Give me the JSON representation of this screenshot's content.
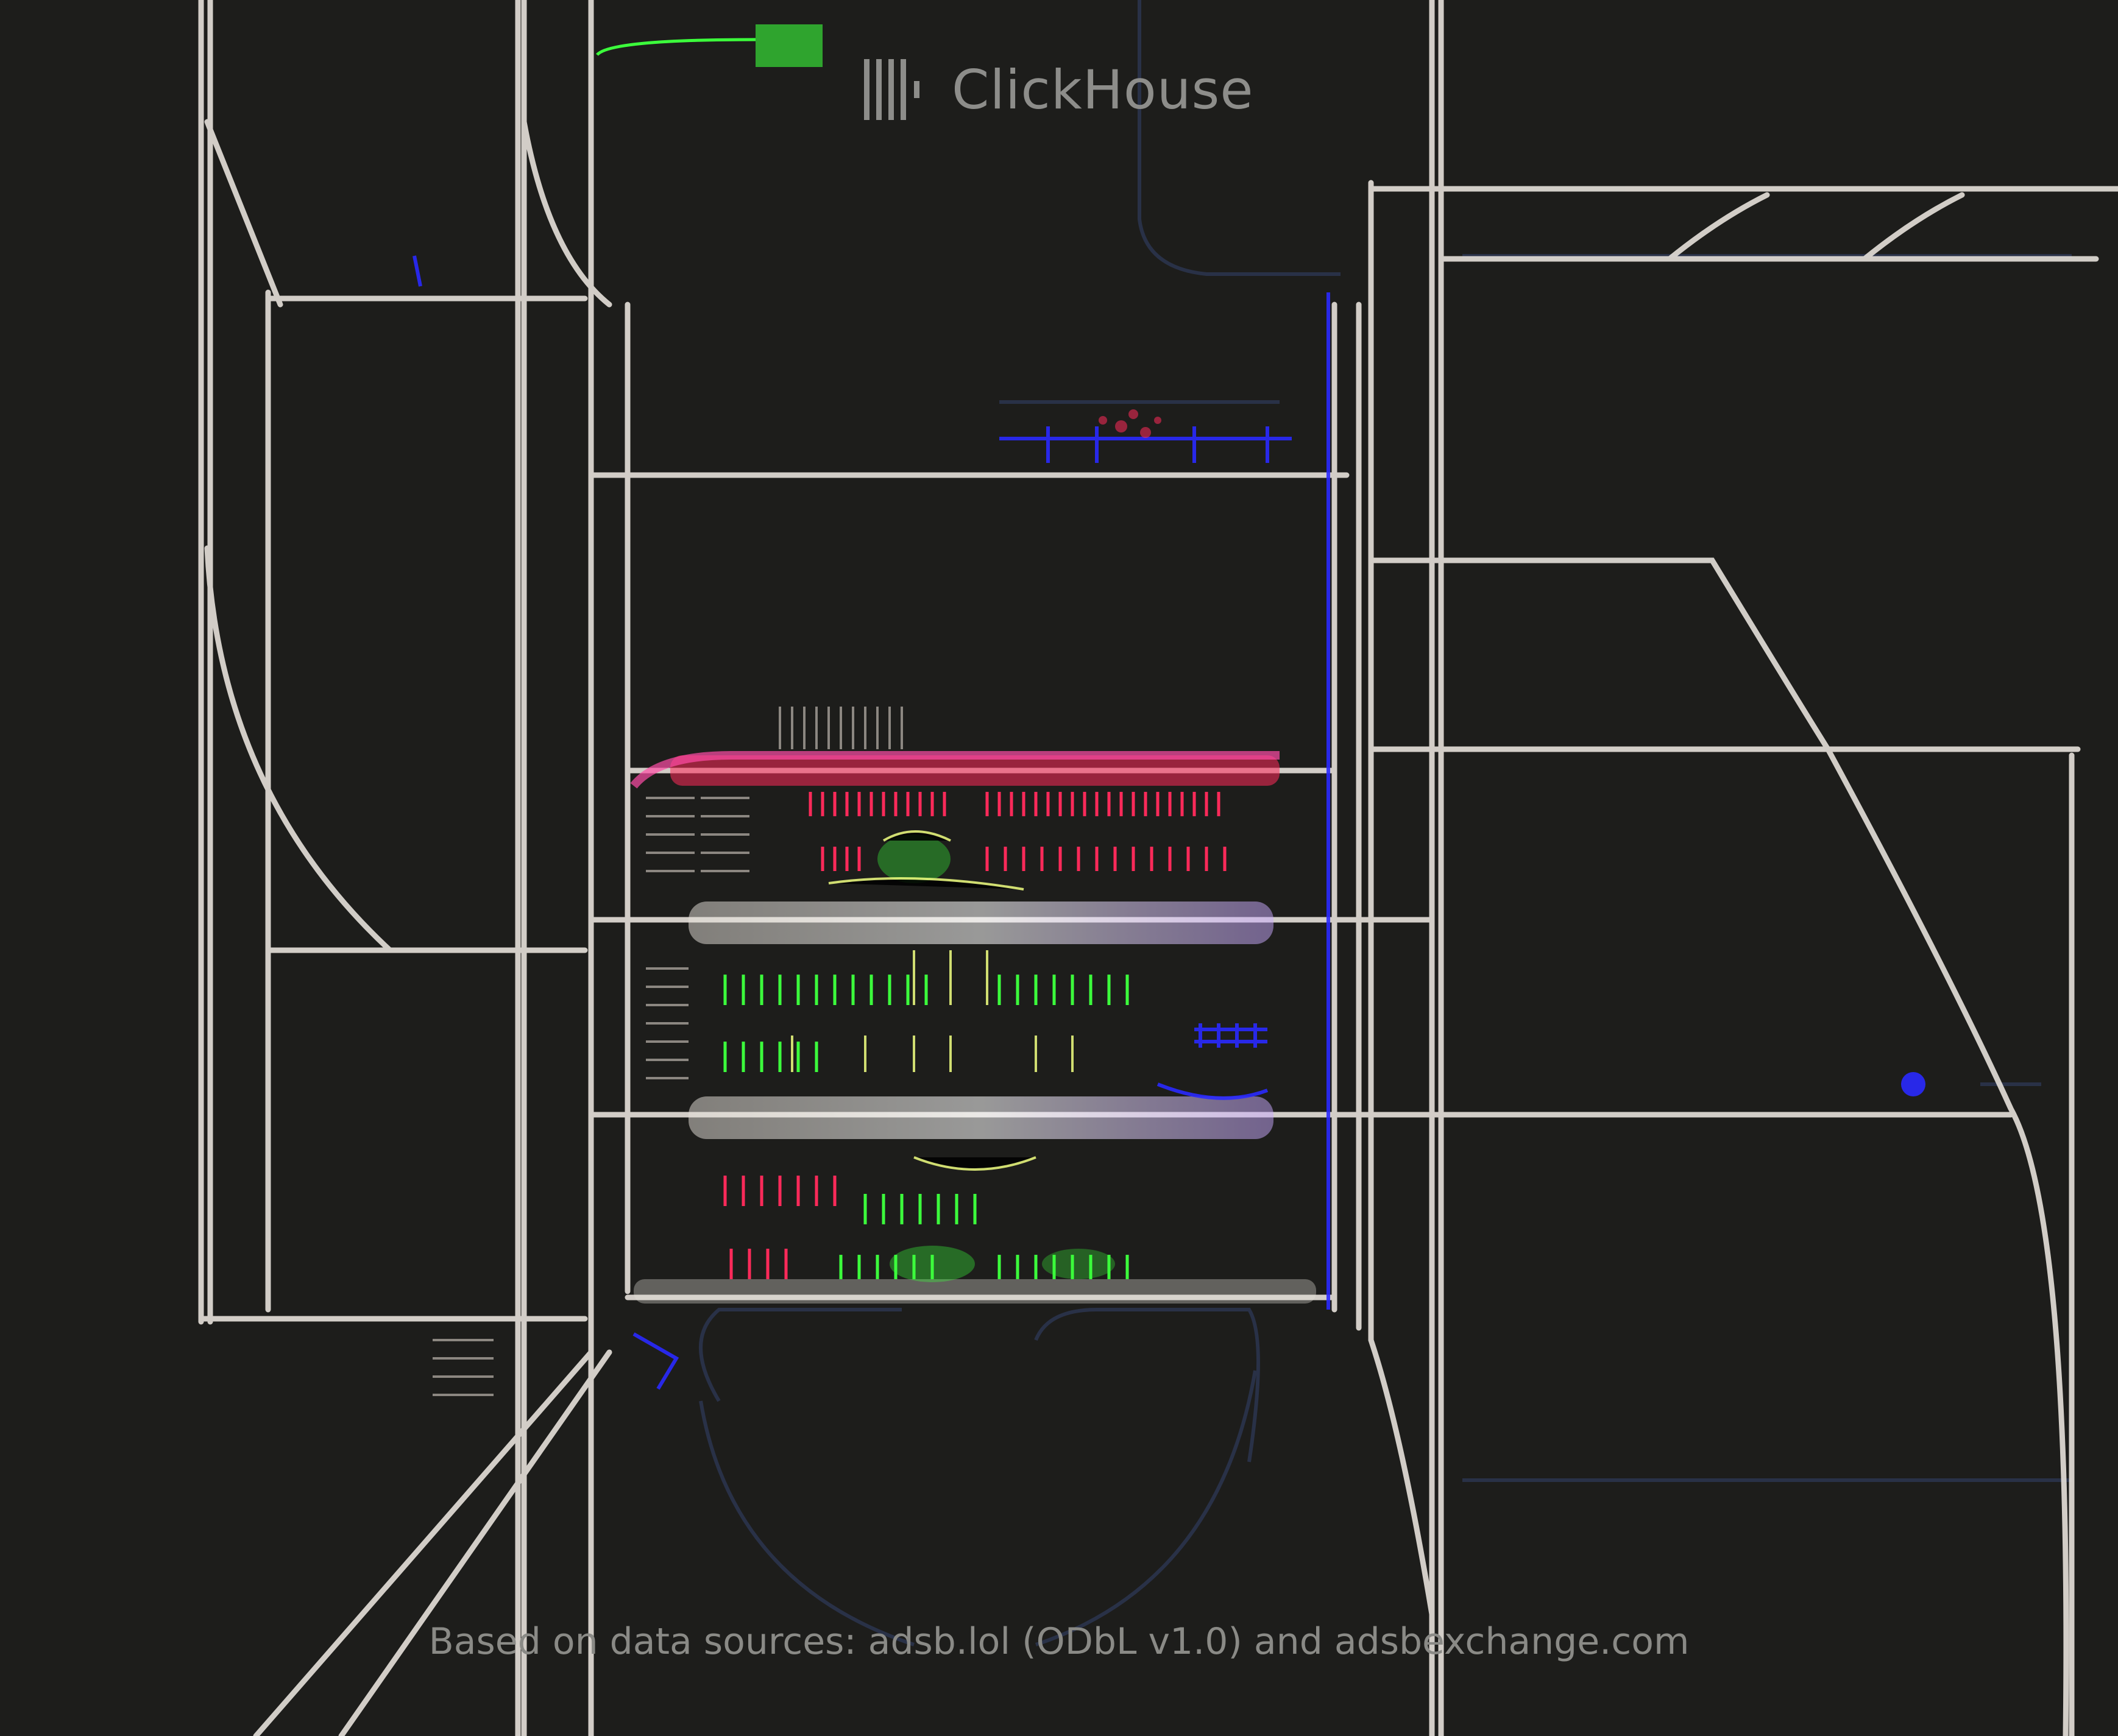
{
  "brand": {
    "name": "ClickHouse",
    "logo_icon": "clickhouse-bars-icon"
  },
  "attribution": "Based on data sources: adsb.lol (ODbL v1.0) and adsbexchange.com",
  "colors": {
    "background": "#1d1d1b",
    "track_white": "#e6e1da",
    "track_red": "#ff2a5a",
    "track_green": "#3cff3c",
    "track_yellow": "#f0ff80",
    "track_blue": "#2a2aff",
    "track_pink": "#ff4da6",
    "text_gray": "#8a8a86"
  }
}
